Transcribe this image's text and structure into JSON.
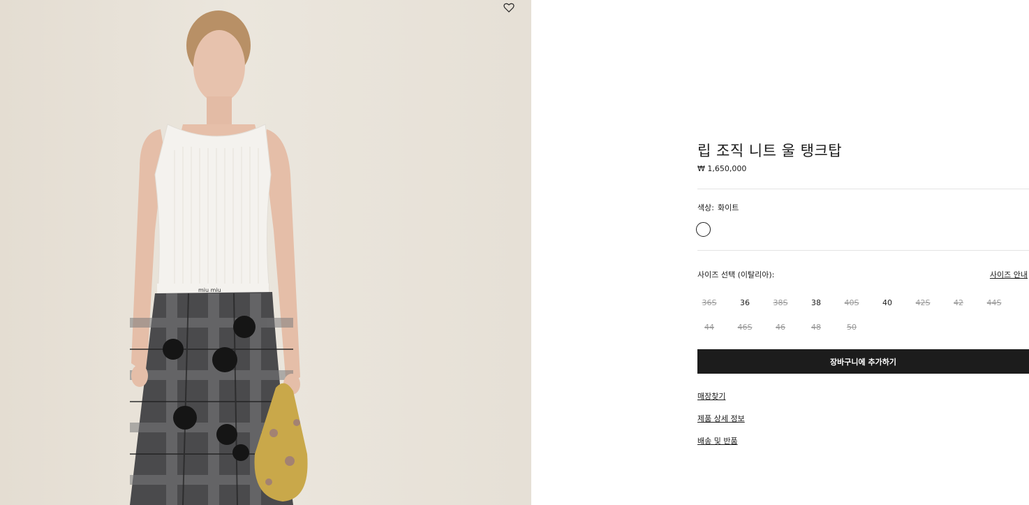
{
  "product": {
    "title": "립 조직 니트 울 탱크탑",
    "price": "₩ 1,650,000",
    "color_label": "색상:",
    "color_value": "화이트",
    "swatch_color": "#ffffff",
    "image_alt": "miu miu"
  },
  "sizes": {
    "heading": "사이즈 선택 (이탈리아):",
    "guide_label": "사이즈 안내",
    "items": [
      {
        "label": "36S",
        "available": false
      },
      {
        "label": "36",
        "available": true
      },
      {
        "label": "38S",
        "available": false
      },
      {
        "label": "38",
        "available": true
      },
      {
        "label": "40S",
        "available": false
      },
      {
        "label": "40",
        "available": true
      },
      {
        "label": "42S",
        "available": false
      },
      {
        "label": "42",
        "available": false
      },
      {
        "label": "44S",
        "available": false
      },
      {
        "label": "44",
        "available": false
      },
      {
        "label": "46S",
        "available": false
      },
      {
        "label": "46",
        "available": false
      },
      {
        "label": "48",
        "available": false
      },
      {
        "label": "50",
        "available": false
      }
    ]
  },
  "actions": {
    "add_to_cart": "장바구니에 추가하기",
    "links": [
      "매장찾기",
      "제품 상세 정보",
      "배송 및 반품"
    ]
  },
  "icons": {
    "wishlist": "heart-outline-icon"
  }
}
